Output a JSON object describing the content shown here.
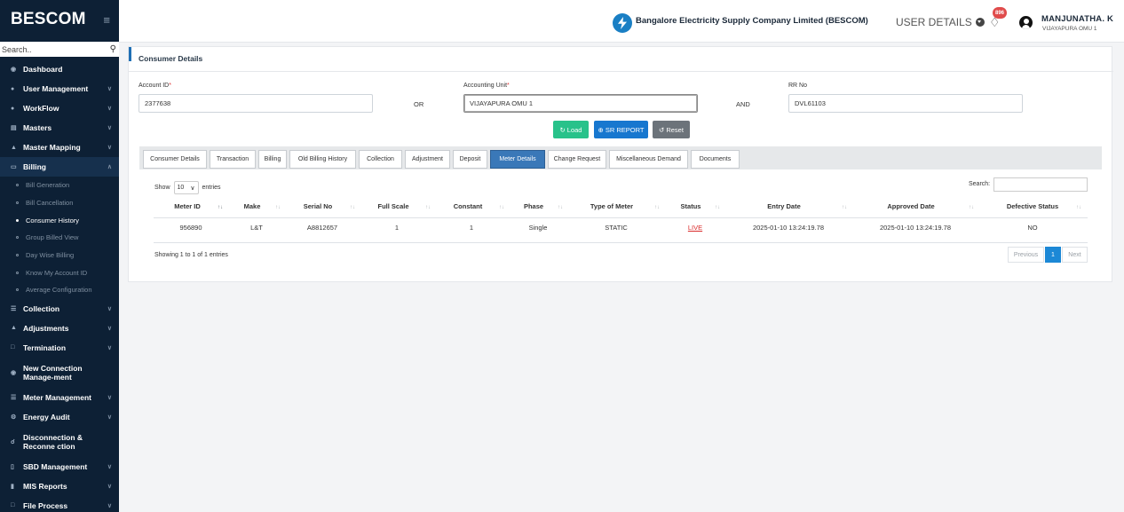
{
  "sidebar": {
    "brand": "BESCOM",
    "search_placeholder": "Search..",
    "menu": [
      {
        "label": "Dashboard",
        "icon": "dashboard-icon"
      },
      {
        "label": "User Management",
        "icon": "user-icon"
      },
      {
        "label": "WorkFlow",
        "icon": "workflow-icon"
      },
      {
        "label": "Masters",
        "icon": "masters-icon"
      },
      {
        "label": "Master Mapping",
        "icon": "mapping-icon"
      },
      {
        "label": "Billing",
        "icon": "billing-icon"
      }
    ],
    "billing_submenu": [
      "Bill Generation",
      "Bill Cancellation",
      "Consumer History",
      "Group Billed View",
      "Day Wise Billing",
      "Know My Account ID",
      "Average Configuration"
    ],
    "menu_after": [
      {
        "label": "Collection",
        "icon": "collection-icon"
      },
      {
        "label": "Adjustments",
        "icon": "adjustments-icon"
      },
      {
        "label": "Termination",
        "icon": "termination-icon"
      },
      {
        "label": "New Connection Manage-ment",
        "icon": "new-connection-icon"
      },
      {
        "label": "Meter Management",
        "icon": "meter-icon"
      },
      {
        "label": "Energy Audit",
        "icon": "energy-audit-icon"
      },
      {
        "label": "Disconnection & Reconne ction",
        "icon": "disconnection-icon"
      },
      {
        "label": "SBD Management",
        "icon": "sbd-icon"
      },
      {
        "label": "MIS Reports",
        "icon": "reports-icon"
      },
      {
        "label": "File Process",
        "icon": "file-icon"
      }
    ]
  },
  "header": {
    "company": "Bangalore Electricity Supply Company Limited (BESCOM)",
    "user_details": "USER DETAILS",
    "notification_count": "896",
    "user_name": "MANJUNATHA. K",
    "user_unit": "VIJAYAPURA OMU 1"
  },
  "card": {
    "title": "Consumer Details",
    "account_id_label": "Account ID",
    "account_id": "2377638",
    "or": "OR",
    "accounting_unit_label": "Accounting Unit",
    "accounting_unit": "VIJAYAPURA OMU 1",
    "and": "AND",
    "rr_label": "RR No",
    "rr_no": "DVL61103",
    "buttons": {
      "load": "Load",
      "sr_report": "SR REPORT",
      "reset": "Reset"
    },
    "tabs": [
      "Consumer Details",
      "Transaction",
      "Billing",
      "Old Billing History",
      "Collection",
      "Adjustment",
      "Deposit",
      "Meter Details",
      "Change Request",
      "Miscellaneous Demand",
      "Documents"
    ],
    "active_tab": "Meter Details"
  },
  "table": {
    "show": "Show",
    "page_size": "10",
    "entries": "entries",
    "search_label": "Search:",
    "columns": [
      "Meter ID",
      "Make",
      "Serial No",
      "Full Scale",
      "Constant",
      "Phase",
      "Type of Meter",
      "Status",
      "Entry Date",
      "Approved Date",
      "Defective Status"
    ],
    "rows": [
      [
        "956890",
        "L&T",
        "A8812657",
        "1",
        "1",
        "Single",
        "STATIC",
        "LIVE",
        "2025-01-10 13:24:19.78",
        "2025-01-10 13:24:19.78",
        "NO"
      ]
    ],
    "info": "Showing 1 to 1 of 1 entries",
    "pagination": {
      "previous": "Previous",
      "current": "1",
      "next": "Next"
    }
  },
  "colors": {
    "sidebar": "#0d2035",
    "active_tab": "#3a78b8",
    "load": "#28c28a",
    "sr": "#1777cf",
    "reset": "#6c737a",
    "live": "#d92a2a"
  }
}
